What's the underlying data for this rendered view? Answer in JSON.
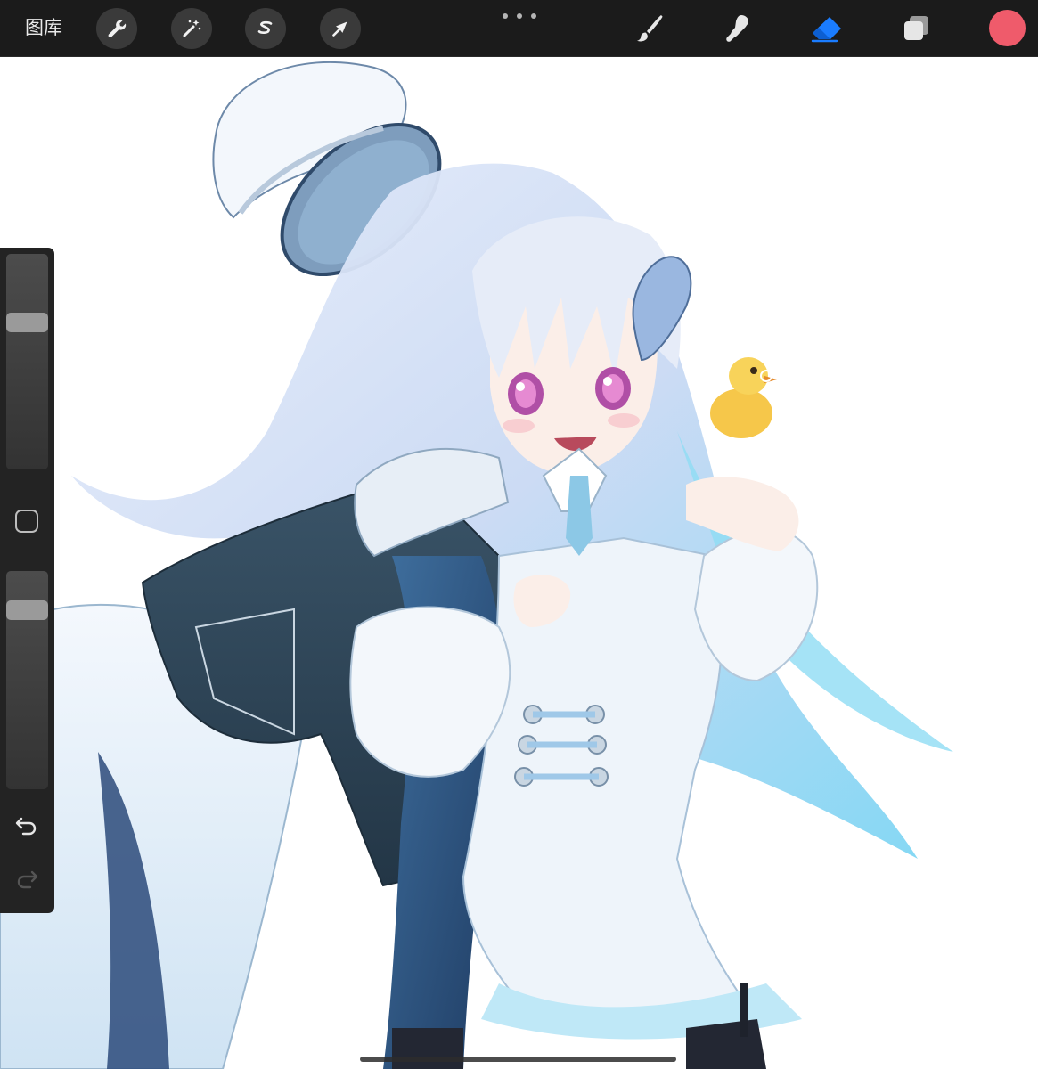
{
  "toolbar": {
    "gallery_label": "图库",
    "left_tools": [
      "wrench-icon",
      "magic-wand-icon",
      "selection-s-icon",
      "transform-arrow-icon"
    ],
    "right_tools": [
      "brush-icon",
      "smudge-icon",
      "eraser-icon",
      "layers-icon"
    ],
    "active_tool": "eraser-icon",
    "active_tool_color": "#1a7cff",
    "current_color": "#ef5b6b"
  },
  "sidebar": {
    "brush_size_level": 0.7,
    "opacity_level": 0.15,
    "undo_icon": "undo-icon",
    "redo_icon": "redo-icon"
  },
  "canvas": {
    "artwork": "illustration-character-with-cap-and-duck",
    "background": "#ffffff"
  }
}
